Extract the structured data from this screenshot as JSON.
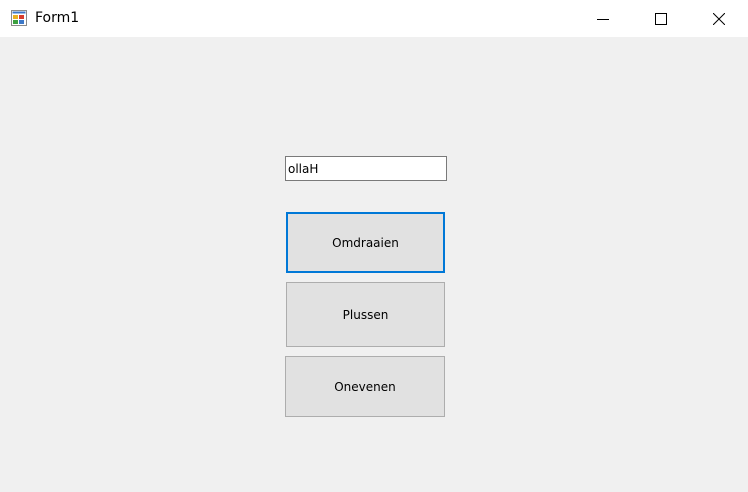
{
  "window": {
    "title": "Form1",
    "app_icon": "winforms-app-icon",
    "controls": {
      "minimize": "minimize-icon",
      "maximize": "maximize-icon",
      "close": "close-icon"
    }
  },
  "form": {
    "textbox_value": "ollaH",
    "buttons": {
      "omdraaien": "Omdraaien",
      "plussen": "Plussen",
      "onevenen": "Onevenen"
    }
  },
  "colors": {
    "focus_border": "#0078d7",
    "button_face": "#e1e1e1",
    "client_background": "#f0f0f0"
  }
}
